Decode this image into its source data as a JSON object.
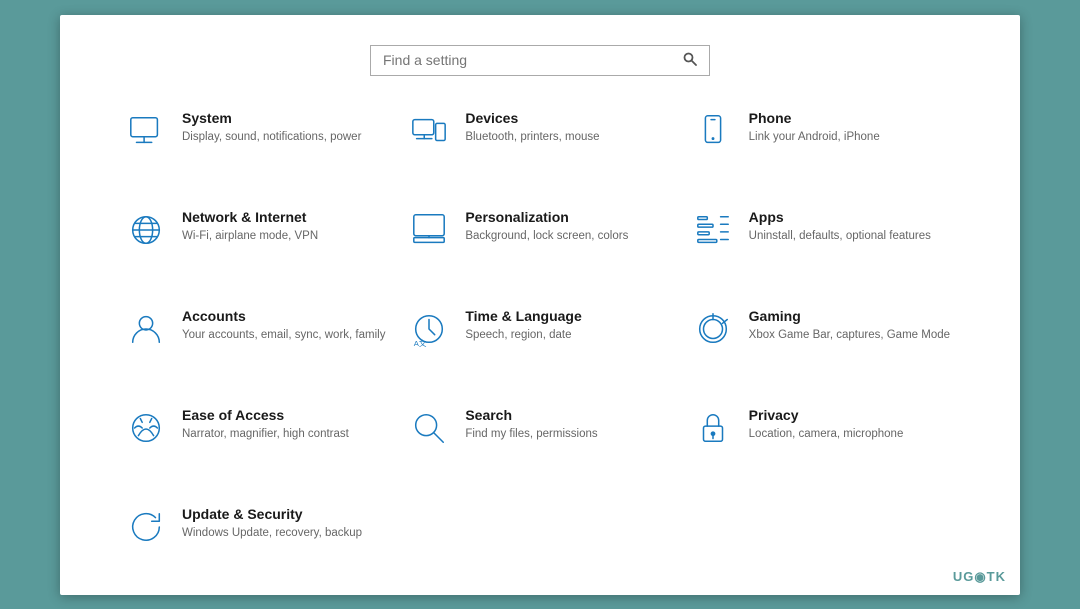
{
  "search": {
    "placeholder": "Find a setting"
  },
  "settings": [
    {
      "id": "system",
      "title": "System",
      "desc": "Display, sound, notifications, power",
      "icon": "system"
    },
    {
      "id": "devices",
      "title": "Devices",
      "desc": "Bluetooth, printers, mouse",
      "icon": "devices"
    },
    {
      "id": "phone",
      "title": "Phone",
      "desc": "Link your Android, iPhone",
      "icon": "phone"
    },
    {
      "id": "network",
      "title": "Network & Internet",
      "desc": "Wi-Fi, airplane mode, VPN",
      "icon": "network"
    },
    {
      "id": "personalization",
      "title": "Personalization",
      "desc": "Background, lock screen, colors",
      "icon": "personalization"
    },
    {
      "id": "apps",
      "title": "Apps",
      "desc": "Uninstall, defaults, optional features",
      "icon": "apps"
    },
    {
      "id": "accounts",
      "title": "Accounts",
      "desc": "Your accounts, email, sync, work, family",
      "icon": "accounts"
    },
    {
      "id": "time",
      "title": "Time & Language",
      "desc": "Speech, region, date",
      "icon": "time"
    },
    {
      "id": "gaming",
      "title": "Gaming",
      "desc": "Xbox Game Bar, captures, Game Mode",
      "icon": "gaming"
    },
    {
      "id": "ease",
      "title": "Ease of Access",
      "desc": "Narrator, magnifier, high contrast",
      "icon": "ease"
    },
    {
      "id": "search",
      "title": "Search",
      "desc": "Find my files, permissions",
      "icon": "search"
    },
    {
      "id": "privacy",
      "title": "Privacy",
      "desc": "Location, camera, microphone",
      "icon": "privacy"
    },
    {
      "id": "update",
      "title": "Update & Security",
      "desc": "Windows Update, recovery, backup",
      "icon": "update"
    }
  ],
  "watermark": "UG◉TK"
}
